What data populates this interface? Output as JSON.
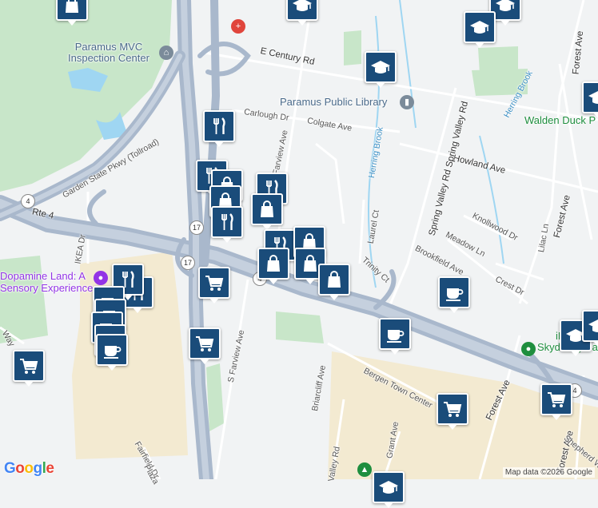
{
  "map": {
    "places": [
      {
        "key": "mvc",
        "text": "Paramus MVC\nInspection Center",
        "kind": "poi"
      },
      {
        "key": "library",
        "text": "Paramus Public Library",
        "kind": "poi"
      },
      {
        "key": "walden",
        "text": "Walden Duck P",
        "kind": "green"
      },
      {
        "key": "dopamine",
        "text": "Dopamine Land: A\nSensory Experience",
        "kind": "purple"
      },
      {
        "key": "ifly",
        "text": "iFLY Indoor\nSkydiving-Paramus",
        "kind": "green"
      }
    ],
    "streets": [
      {
        "key": "century",
        "text": "E Century Rd"
      },
      {
        "key": "carlough",
        "text": "Carlough Dr"
      },
      {
        "key": "colgate",
        "text": "Colgate Ave"
      },
      {
        "key": "howland",
        "text": "Howland Ave"
      },
      {
        "key": "gsp",
        "text": "Garden State Pkwy (Tollroad)"
      },
      {
        "key": "nfairview",
        "text": "N Farview Ave"
      },
      {
        "key": "sfairview",
        "text": "S Farview Ave"
      },
      {
        "key": "herring1",
        "text": "Herring Brook"
      },
      {
        "key": "herring2",
        "text": "Herring Brook"
      },
      {
        "key": "springvalley",
        "text": "Spring Valley Rd Spring Valley Rd"
      },
      {
        "key": "rte4",
        "text": "Rte 4"
      },
      {
        "key": "ikea",
        "text": "IKEA Dr"
      },
      {
        "key": "laurel",
        "text": "Laurel Ct"
      },
      {
        "key": "trinity",
        "text": "Trinity Ct"
      },
      {
        "key": "knollwood",
        "text": "Knollwood Dr"
      },
      {
        "key": "meadow",
        "text": "Meadow Ln"
      },
      {
        "key": "brookfield",
        "text": "Brookfield Ave"
      },
      {
        "key": "crest",
        "text": "Crest Dr"
      },
      {
        "key": "lilac",
        "text": "Lilac Ln"
      },
      {
        "key": "forest1",
        "text": "Forest Ave"
      },
      {
        "key": "forest2",
        "text": "Forest Ave"
      },
      {
        "key": "forest3",
        "text": "Forest Ave"
      },
      {
        "key": "forest4",
        "text": "Forest Ave"
      },
      {
        "key": "bergen",
        "text": "Bergen Town Center"
      },
      {
        "key": "briarcliff",
        "text": "Briarcliff Ave"
      },
      {
        "key": "grant",
        "text": "Grant Ave"
      },
      {
        "key": "valley",
        "text": "Valley Rd"
      },
      {
        "key": "fairfield",
        "text": "Fairfield Dr"
      },
      {
        "key": "plaza",
        "text": "Plaza"
      },
      {
        "key": "shepherd",
        "text": "Shepherd W"
      },
      {
        "key": "way",
        "text": "Way"
      }
    ],
    "shields": [
      {
        "key": "s4a",
        "text": "4"
      },
      {
        "key": "s17a",
        "text": "17"
      },
      {
        "key": "s17b",
        "text": "17"
      },
      {
        "key": "s4b",
        "text": "4"
      },
      {
        "key": "s4c",
        "text": "4"
      }
    ],
    "markers": [
      {
        "type": "shopping",
        "icon": "shopping-bag-icon"
      },
      {
        "type": "school",
        "icon": "graduation-cap-icon"
      },
      {
        "type": "school",
        "icon": "graduation-cap-icon"
      },
      {
        "type": "school",
        "icon": "graduation-cap-icon"
      },
      {
        "type": "school",
        "icon": "graduation-cap-icon"
      },
      {
        "type": "school",
        "icon": "graduation-cap-icon"
      },
      {
        "type": "restaurant",
        "icon": "fork-knife-icon"
      },
      {
        "type": "restaurant",
        "icon": "fork-knife-icon"
      },
      {
        "type": "shopping",
        "icon": "shopping-bag-icon"
      },
      {
        "type": "restaurant",
        "icon": "fork-knife-icon"
      },
      {
        "type": "shopping",
        "icon": "shopping-bag-icon"
      },
      {
        "type": "restaurant",
        "icon": "fork-knife-icon"
      },
      {
        "type": "shopping",
        "icon": "shopping-bag-icon"
      },
      {
        "type": "restaurant",
        "icon": "fork-knife-icon"
      },
      {
        "type": "shopping",
        "icon": "shopping-bag-icon"
      },
      {
        "type": "shopping",
        "icon": "shopping-bag-icon"
      },
      {
        "type": "shopping",
        "icon": "shopping-bag-icon"
      },
      {
        "type": "shopping",
        "icon": "shopping-bag-icon"
      },
      {
        "type": "restaurant",
        "icon": "fork-knife-icon"
      },
      {
        "type": "restaurant",
        "icon": "fork-knife-icon"
      },
      {
        "type": "cafe",
        "icon": "coffee-cup-icon"
      },
      {
        "type": "cafe",
        "icon": "coffee-cup-icon"
      },
      {
        "type": "cafe",
        "icon": "coffee-cup-icon"
      },
      {
        "type": "cafe",
        "icon": "coffee-cup-icon"
      },
      {
        "type": "cafe",
        "icon": "coffee-cup-icon"
      },
      {
        "type": "grocery",
        "icon": "shopping-cart-icon"
      },
      {
        "type": "grocery",
        "icon": "shopping-cart-icon"
      },
      {
        "type": "cafe",
        "icon": "coffee-cup-icon"
      },
      {
        "type": "cafe",
        "icon": "coffee-cup-icon"
      },
      {
        "type": "school",
        "icon": "graduation-cap-icon"
      },
      {
        "type": "school",
        "icon": "graduation-cap-icon"
      },
      {
        "type": "grocery",
        "icon": "shopping-cart-icon"
      },
      {
        "type": "grocery",
        "icon": "shopping-cart-icon"
      },
      {
        "type": "grocery",
        "icon": "shopping-cart-icon"
      },
      {
        "type": "school",
        "icon": "graduation-cap-icon"
      }
    ],
    "colors": {
      "background": "#f1f3f4",
      "park": "#c8e6c9",
      "commercial": "#f3ead1",
      "highway": "#a9b8cc",
      "water": "#9fd6f2",
      "marker": "#1a4c7a"
    }
  },
  "logo": "Google",
  "credit": "Map data ©2026 Google"
}
